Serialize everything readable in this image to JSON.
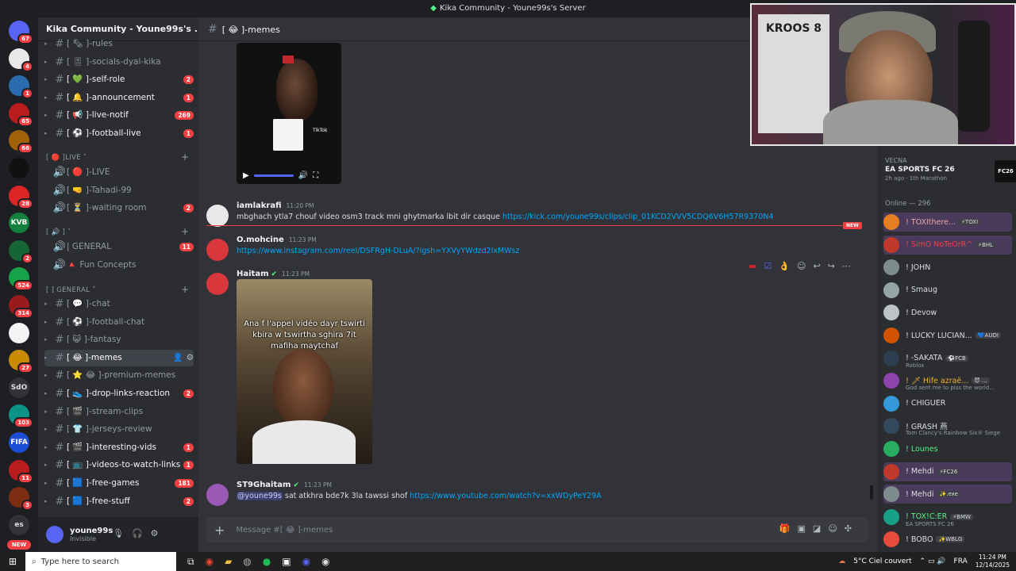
{
  "window": {
    "title": "Kika Community - Youne99s's Server"
  },
  "servers": [
    {
      "badge": "67",
      "color": "#5865f2"
    },
    {
      "badge": "4",
      "color": "#e8e8e8"
    },
    {
      "badge": "1",
      "color": "#2b6cb0"
    },
    {
      "badge": "65",
      "color": "#b91c1c"
    },
    {
      "badge": "66",
      "color": "#a16207"
    },
    {
      "badge": "",
      "color": "#111111"
    },
    {
      "badge": "28",
      "color": "#dc2626"
    },
    {
      "badge": "",
      "color": "#15803d",
      "label": "KVB"
    },
    {
      "badge": "2",
      "color": "#166534"
    },
    {
      "badge": "524",
      "color": "#16a34a"
    },
    {
      "badge": "314",
      "color": "#991b1b"
    },
    {
      "badge": "",
      "color": "#f2f3f5"
    },
    {
      "badge": "27",
      "color": "#ca8a04"
    },
    {
      "badge": "",
      "color": "#313338",
      "label": "SdO"
    },
    {
      "badge": "103",
      "color": "#0d9488"
    },
    {
      "badge": "",
      "color": "#1d4ed8",
      "label": "FIFA"
    },
    {
      "badge": "11",
      "color": "#b91c1c"
    },
    {
      "badge": "3",
      "color": "#7c2d12"
    },
    {
      "badge": "",
      "color": "#313338",
      "label": "es"
    }
  ],
  "rail_new_label": "NEW",
  "sidebar": {
    "server_name": "Kika Community - Youne99s's ...",
    "channels": [
      {
        "name": "[ 🗞 ]-rules",
        "count": "",
        "type": "text"
      },
      {
        "name": "[ 🎚 ]-socials-dyal-kika",
        "count": "",
        "type": "text"
      },
      {
        "name": "[ 💚 ]-self-role",
        "count": "2",
        "type": "text"
      },
      {
        "name": "[ 🔔 ]-announcement",
        "count": "1",
        "type": "text"
      },
      {
        "name": "[ 📢 ]-live-notif",
        "count": "269",
        "type": "text"
      },
      {
        "name": "[ ⚽ ]-football-live",
        "count": "1",
        "type": "text"
      }
    ],
    "cat1": "[ 🔴 ]LIVE",
    "voice1": [
      {
        "name": "[ 🔴 ]-LIVE",
        "count": ""
      },
      {
        "name": "[ 🤜 ]-Tahadi-99",
        "count": ""
      },
      {
        "name": "[ ⏳ ]-waiting room",
        "count": "2"
      }
    ],
    "cat2": "[ 🔊 ]",
    "voice2": [
      {
        "name": "| GENERAL",
        "count": "11"
      },
      {
        "name": "🔺 Fun Concepts",
        "count": ""
      }
    ],
    "cat3": "[ ] GENERAL",
    "channels2": [
      {
        "name": "[ 💬 ]-chat",
        "count": ""
      },
      {
        "name": "[ ⚽ ]-football-chat",
        "count": ""
      },
      {
        "name": "[ 😺 ]-fantasy",
        "count": ""
      },
      {
        "name": "[ 😂 ]-memes",
        "count": "",
        "active": true
      },
      {
        "name": "[ ⭐ 😂 ]-premium-memes",
        "count": ""
      },
      {
        "name": "[ 👟 ]-drop-links-reaction",
        "count": "2"
      },
      {
        "name": "[ 🎬 ]-stream-clips",
        "count": ""
      },
      {
        "name": "[ 👕 ]-jerseys-review",
        "count": ""
      },
      {
        "name": "[ 🎬 ]-interesting-vids",
        "count": "1"
      },
      {
        "name": "[ 📺 ]-videos-to-watch-links",
        "count": "1"
      },
      {
        "name": "[ 🟦 ]-free-games",
        "count": "181"
      },
      {
        "name": "[ 🟦 ]-free-stuff",
        "count": "2"
      }
    ],
    "user": {
      "name": "youne99s",
      "status": "Invisible"
    }
  },
  "channel": {
    "header": "[ 😂 ]-memes",
    "placeholder": "Message #[ 😂 ]-memes"
  },
  "messages": [
    {
      "author": "iamlakrafi",
      "time": "11:20 PM",
      "text": "mbghach ytla7 chouf video osm3 track mni ghytmarka lbit dir casque ",
      "link": "https://kick.com/youne99s/clips/clip_01KCD2VVV5CDQ6V6H57R9370N4",
      "avatar": "#e8e8e8"
    },
    {
      "author": "O.mohcine",
      "time": "11:23 PM",
      "text": "",
      "link": "https://www.instagram.com/reel/DSFRgH-DLuA/?igsh=YXVyYWdzd2lxMWsz",
      "avatar": "#da373c"
    },
    {
      "author": "Haitam",
      "time": "11:23 PM",
      "text": "",
      "link": "",
      "avatar": "#da373c"
    },
    {
      "author": "ST9Ghaitam",
      "time": "11:23 PM",
      "mention": "@youne99s",
      "text": " sat atkhra bde7k 3la tawssi shof ",
      "link": "https://www.youtube.com/watch?v=xxWDyPeY29A",
      "avatar": "#9b59b6"
    }
  ],
  "new_badge": "NEW",
  "video": {
    "tiktok_label": "TikTok"
  },
  "photo_caption": "Ana f l'appel vidéo dayr tswirti kbira w tswirtha sghira 7it mafiha maytchaf",
  "webcam": {
    "jersey_text": "KROOS 8"
  },
  "activity": {
    "user": "VECNA",
    "game": "EA SPORTS FC 26",
    "detail": "2h ago · 1th Marathon",
    "logo": "FC26"
  },
  "online_header": "Online — 296",
  "members": [
    {
      "name": "! TOXIthere...",
      "tag": "⚡TOXI",
      "sub": "",
      "color": "#e8a5a5",
      "hl": true
    },
    {
      "name": "! SimO NoTeOrR^",
      "tag": "⚡BHL",
      "sub": "",
      "color": "#f23f43",
      "hl": true
    },
    {
      "name": "! JOHN",
      "tag": "",
      "sub": "",
      "color": "#dbdee1"
    },
    {
      "name": "! Smaug",
      "tag": "",
      "sub": "",
      "color": "#dbdee1"
    },
    {
      "name": "! Devow",
      "tag": "",
      "sub": "",
      "color": "#dbdee1"
    },
    {
      "name": "! LUCKY LUCIAN...",
      "tag": "💙AUDI",
      "sub": "",
      "color": "#dbdee1"
    },
    {
      "name": "! -SAKATA",
      "tag": "⚽FCB",
      "sub": "Roblox",
      "color": "#dbdee1"
    },
    {
      "name": "! 🗡 Hife azraë...",
      "tag": "😈 ...",
      "sub": "God sent me to piss the world...",
      "color": "#f0b232"
    },
    {
      "name": "! CHIGUER",
      "tag": "",
      "sub": "",
      "color": "#dbdee1"
    },
    {
      "name": "! GRASH 燕",
      "tag": "",
      "sub": "Tom Clancy's Rainbow Six® Siege",
      "color": "#dbdee1"
    },
    {
      "name": "! Lounes",
      "tag": "",
      "sub": "",
      "color": "#57f287"
    },
    {
      "name": "! Mehdi",
      "tag": "⚡FC26",
      "sub": "",
      "color": "#dbdee1",
      "hl": true
    },
    {
      "name": "! Mehdi",
      "tag": "✨.exe",
      "sub": "",
      "color": "#dbdee1",
      "hl": true
    },
    {
      "name": "! TOX!C:ER",
      "tag": "⚡BMW",
      "sub": "EA SPORTS FC 26",
      "color": "#57f287"
    },
    {
      "name": "! BOBO",
      "tag": "✨WBLG",
      "sub": "",
      "color": "#dbdee1"
    }
  ],
  "taskbar": {
    "search_placeholder": "Type here to search",
    "weather": "5°C Ciel couvert",
    "lang": "FRA",
    "time": "11:24 PM",
    "date": "12/14/2025"
  }
}
